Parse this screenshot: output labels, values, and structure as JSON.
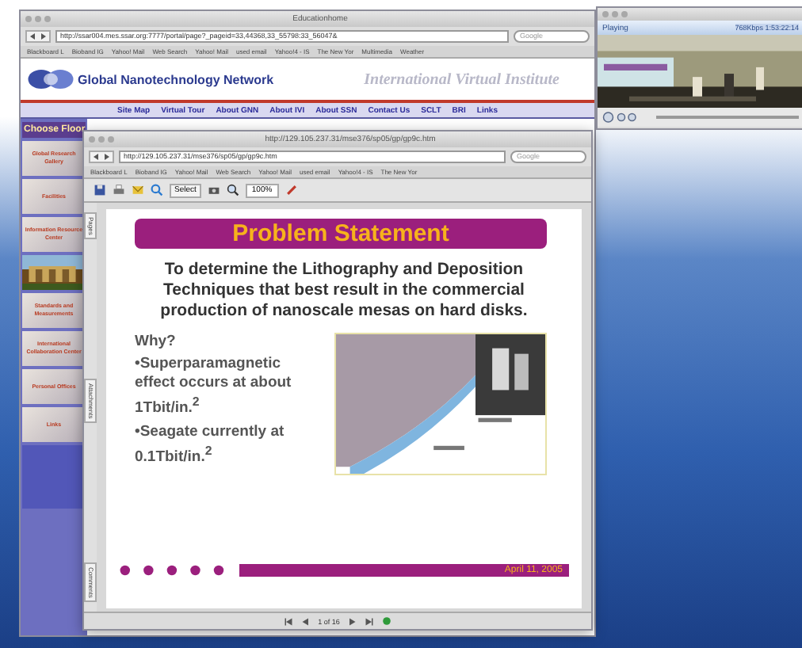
{
  "back_window": {
    "title": "Educationhome",
    "url": "http://ssar004.mes.ssar.org:7777/portal/page?_pageid=33,44368,33_55798:33_56047&",
    "search_placeholder": "Google",
    "bookmarks": [
      "Blackboard L",
      "Bioband IG",
      "Yahoo! Mail",
      "Web Search",
      "Yahoo! Mail",
      "used email",
      "Yahoo!4 - IS",
      "The New Yor",
      "Multimedia",
      "Weather"
    ],
    "site": {
      "logo_text": "Global Nanotechnology Network",
      "banner": "International Virtual Institute",
      "nav": [
        "Site Map",
        "Virtual Tour",
        "About GNN",
        "About IVI",
        "About SSN",
        "Contact Us",
        "SCLT",
        "BRI",
        "Links"
      ],
      "floor_heading": "Choose Floor",
      "floors": [
        {
          "label": "Global Research Gallery",
          "kind": "tile"
        },
        {
          "label": "Facilities",
          "kind": "tile"
        },
        {
          "label": "Information Resource Center",
          "kind": "tile"
        },
        {
          "kind": "picture"
        },
        {
          "label": "Standards and Measurements",
          "kind": "tile"
        },
        {
          "label": "International Collaboration Center",
          "kind": "tile"
        },
        {
          "label": "Personal Offices",
          "kind": "tile"
        },
        {
          "label": "Links",
          "kind": "tile"
        }
      ]
    }
  },
  "front_window": {
    "title": "http://129.105.237.31/mse376/sp05/gp/gp9c.htm",
    "url": "http://129.105.237.31/mse376/sp05/gp/gp9c.htm",
    "search_placeholder": "Google",
    "bookmarks": [
      "Blackboard L",
      "Bioband IG",
      "Yahoo! Mail",
      "Web Search",
      "Yahoo! Mail",
      "used email",
      "Yahoo!4 - IS",
      "The New Yor"
    ],
    "toolbar": {
      "select": "Select",
      "zoom": "100%"
    },
    "side_tabs": [
      "Pages",
      "Attachments",
      "Comments"
    ],
    "slide": {
      "title": "Problem Statement",
      "statement": "To determine the Lithography and Deposition Techniques that best result in the commercial production of nanoscale mesas on hard disks.",
      "why": "Why?",
      "bullets": [
        "•Superparamagnetic effect occurs at about 1Tbit/in.$^{2}$",
        "•Seagate currently at 0.1Tbit/in.$^{2}$"
      ],
      "date": "April 11, 2005"
    },
    "page_indicator": "1 of 16"
  },
  "video_window": {
    "status": "Playing",
    "time": "768Kbps 1:53:22:14"
  }
}
